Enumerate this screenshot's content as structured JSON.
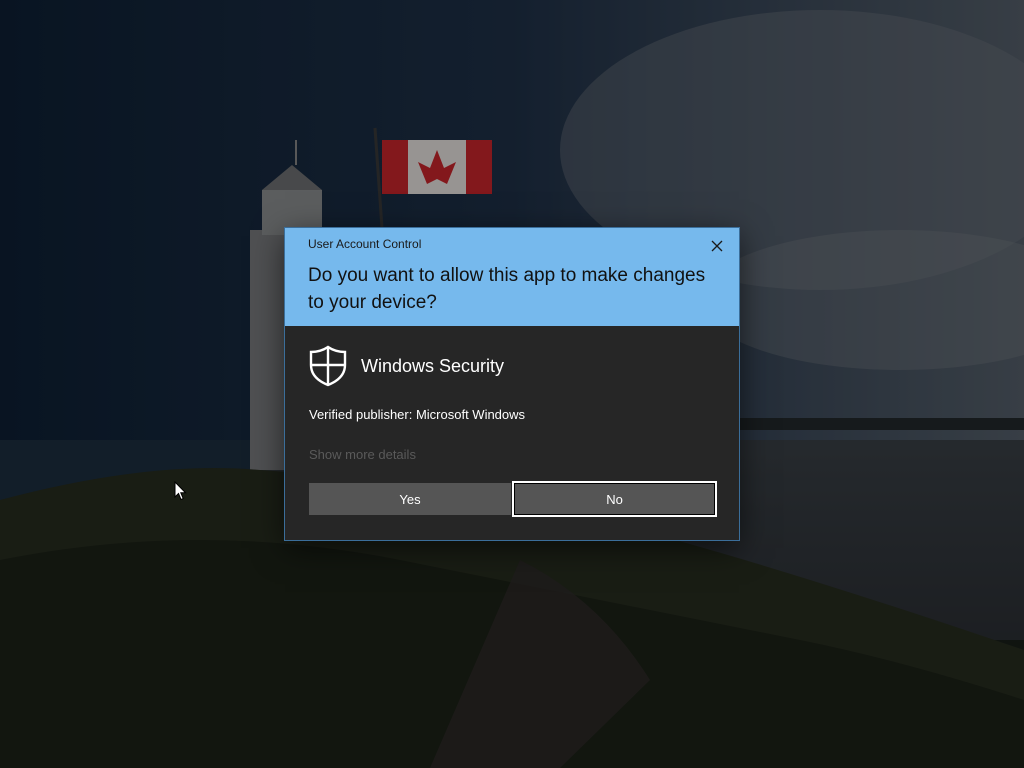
{
  "dialog": {
    "window_title": "User Account Control",
    "question": "Do you want to allow this app to make changes to your device?",
    "app_name": "Windows Security",
    "publisher": "Verified publisher: Microsoft Windows",
    "details_link": "Show more details",
    "yes_label": "Yes",
    "no_label": "No",
    "close_icon": "close-icon",
    "app_icon": "shield-icon"
  },
  "colors": {
    "header": "#76b9ed",
    "body": "#262626",
    "button": "#555555",
    "text": "#ffffff"
  }
}
